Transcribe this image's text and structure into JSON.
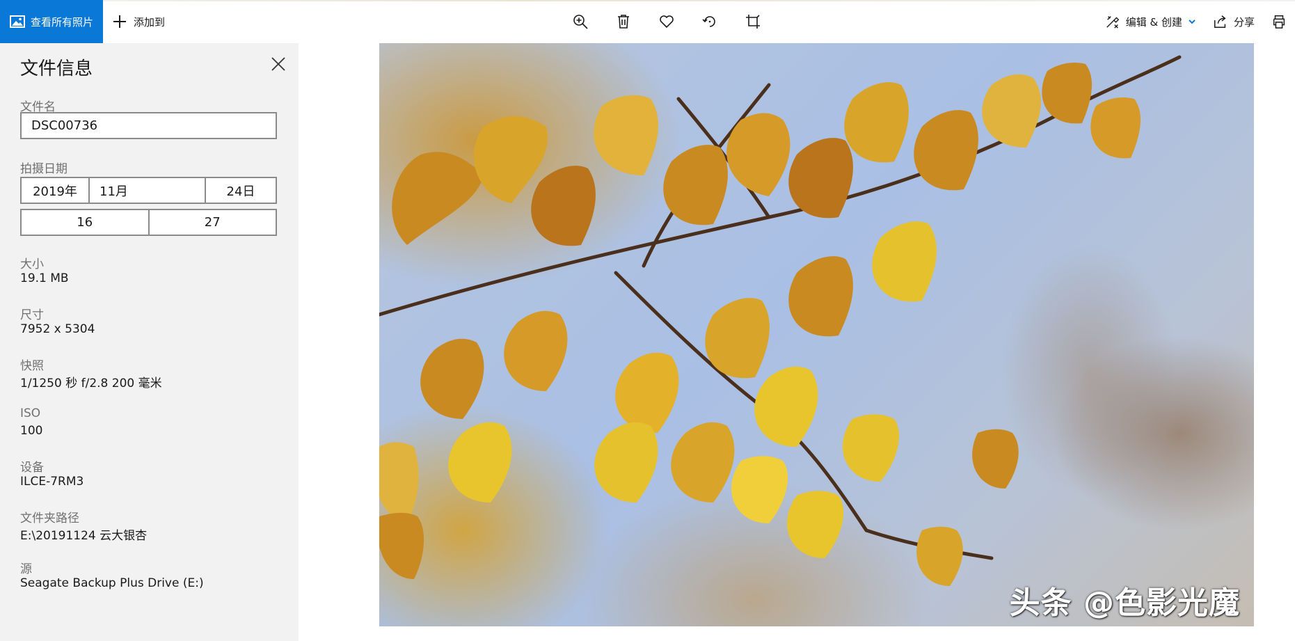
{
  "toolbar": {
    "view_all_label": "查看所有照片",
    "add_to_label": "添加到",
    "edit_create_label": "编辑 & 创建",
    "share_label": "分享",
    "accent_color": "#0a78d7"
  },
  "panel": {
    "title": "文件信息",
    "filename_label": "文件名",
    "filename_value": "DSC00736",
    "date_label": "拍摄日期",
    "date_year": "2019年",
    "date_month": "11月",
    "date_day": "24日",
    "time_hour": "16",
    "time_minute": "27",
    "fields": [
      {
        "label": "大小",
        "value": "19.1 MB"
      },
      {
        "label": "尺寸",
        "value": "7952 x 5304"
      },
      {
        "label": "快照",
        "value": "1/1250 秒 f/2.8 200 毫米"
      },
      {
        "label": "ISO",
        "value": "100"
      },
      {
        "label": "设备",
        "value": "ILCE-7RM3"
      },
      {
        "label": "文件夹路径",
        "value": "E:\\20191124 云大银杏"
      },
      {
        "label": "源",
        "value": "Seagate Backup Plus Drive (E:)"
      }
    ]
  },
  "photo": {
    "watermark": "头条 @色影光魔"
  }
}
